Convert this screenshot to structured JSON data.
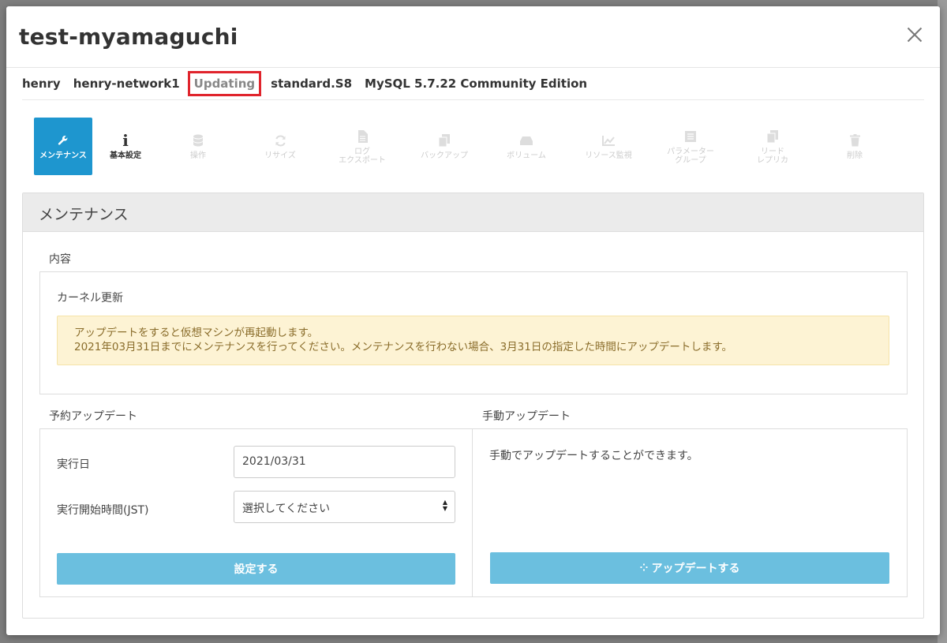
{
  "modal": {
    "title": "test-myamaguchi",
    "info": {
      "user": "henry",
      "network": "henry-network1",
      "status": "Updating",
      "plan": "standard.S8",
      "engine": "MySQL 5.7.22 Community Edition"
    }
  },
  "toolbar": [
    {
      "label": "メンテナンス",
      "icon": "wrench-icon",
      "state": "active"
    },
    {
      "label": "基本設定",
      "icon": "info-icon",
      "state": "enabled"
    },
    {
      "label": "操作",
      "icon": "database-icon",
      "state": "disabled"
    },
    {
      "label": "リサイズ",
      "icon": "refresh-icon",
      "state": "disabled"
    },
    {
      "label": "ログ\nエクスポート",
      "icon": "file-icon",
      "state": "disabled"
    },
    {
      "label": "バックアップ",
      "icon": "copy-icon",
      "state": "disabled"
    },
    {
      "label": "ボリューム",
      "icon": "drive-icon",
      "state": "disabled"
    },
    {
      "label": "リソース監視",
      "icon": "chart-icon",
      "state": "disabled"
    },
    {
      "label": "パラメーター\nグループ",
      "icon": "list-icon",
      "state": "disabled"
    },
    {
      "label": "リード\nレプリカ",
      "icon": "replica-icon",
      "state": "disabled"
    },
    {
      "label": "削除",
      "icon": "trash-icon",
      "state": "disabled"
    }
  ],
  "panel": {
    "title": "メンテナンス",
    "content_label": "内容",
    "kernel_title": "カーネル更新",
    "alert_line1": "アップデートをすると仮想マシンが再起動します。",
    "alert_line2": "2021年03月31日までにメンテナンスを行ってください。メンテナンスを行わない場合、3月31日の指定した時間にアップデートします。",
    "scheduled": {
      "label": "予約アップデート",
      "date_label": "実行日",
      "date_value": "2021/03/31",
      "time_label": "実行開始時間(JST)",
      "time_value": "選択してください",
      "submit_label": "設定する"
    },
    "manual": {
      "label": "手動アップデート",
      "text": "手動でアップデートすることができます。",
      "button_label": "アップデートする"
    }
  }
}
